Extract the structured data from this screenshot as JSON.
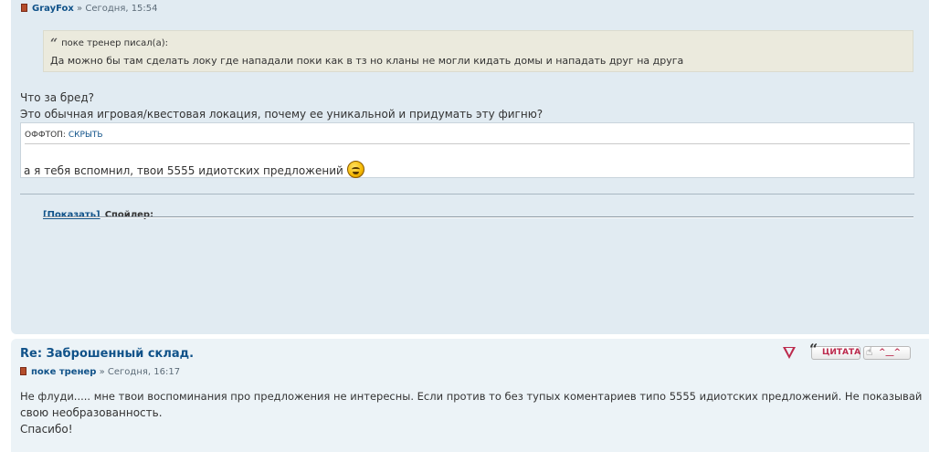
{
  "post1": {
    "author": "GrayFox",
    "separator": "»",
    "date": "Сегодня, 15:54",
    "quote": {
      "author_line": "поке тренер писал(а):",
      "text": "Да можно бы там сделать локу где нападали поки как в тз но кланы не могли кидать домы и нападать друг на друга"
    },
    "message_lines": [
      "Что за бред?",
      "Это обычная игровая/квестовая локация, почему ее уникальной и придумать эту фигню?"
    ],
    "offtop": {
      "label": "ОФФТОП:",
      "toggle": "СКРЫТЬ",
      "text": "а я тебя вспомнил, твои 5555 идиотских предложений"
    },
    "spoiler": {
      "show_label": "[Показать]",
      "label": "Спойлер:"
    }
  },
  "post2": {
    "title": "Re: Заброшенный склад.",
    "author": "поке тренер",
    "separator": "»",
    "date": "Сегодня, 16:17",
    "actions": {
      "report": "!",
      "quote": "ЦИТАТА",
      "like": "^__^"
    },
    "message_lines": [
      "Не флуди..... мне твои воспоминания про предложения не интересны. Если против то без тупых коментариев типо 5555 идиотских предложений. Не показывай",
      "свою необразованность.",
      "Спасибо!"
    ]
  },
  "colors": {
    "post_bg_1": "#e1ebf2",
    "post_bg_2": "#ecf3f7",
    "link": "#105289",
    "accent_red": "#bc2a4d",
    "quote_bg": "#ebeadd"
  }
}
